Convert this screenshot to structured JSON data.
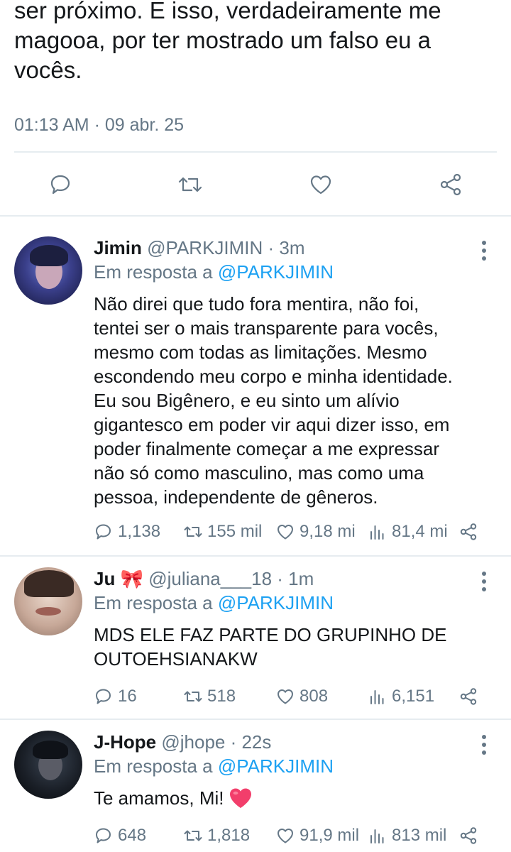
{
  "tweet": {
    "lines": [
      "ser próximo. E isso, verdadeiramente me",
      "magooa, por ter mostrado um falso eu a",
      "vocês."
    ],
    "timestamp": "01:13 AM · 09 abr. 25",
    "actions": [
      "reply-icon",
      "retweet-icon",
      "like-icon",
      "share-icon"
    ]
  },
  "replies": [
    {
      "name": "Jimin",
      "handle": "@PARKJIMIN · 3m",
      "reply_prefix": "Em resposta a ",
      "reply_mention": "@PARKJIMIN",
      "lines": [
        "Não direi que tudo fora mentira, não foi,",
        "tentei ser o mais transparente para vocês,",
        "mesmo com todas as limitações. Mesmo",
        "escondendo meu corpo e minha identidade.",
        "Eu sou Bigênero, e eu sinto um alívio",
        "gigantesco em poder vir aqui dizer isso, em",
        "poder finalmente começar a me expressar",
        "não só como masculino, mas como uma",
        "pessoa, independente de gêneros."
      ],
      "replies": "1,138",
      "retweets": "155 mil",
      "likes": "9,18 mi",
      "views": "81,4 mi"
    },
    {
      "name": "Ju",
      "name_emoji": "🎀",
      "handle": "@juliana___18 · 1m",
      "reply_prefix": "Em resposta a ",
      "reply_mention": "@PARKJIMIN",
      "lines": [
        "MDS ELE FAZ PARTE DO GRUPINHO DE",
        "OUTOEHSIANAKW"
      ],
      "replies": "16",
      "retweets": "518",
      "likes": "808",
      "views": "6,151"
    },
    {
      "name": "J-Hope",
      "handle": "@jhope · 22s",
      "reply_prefix": "Em resposta a ",
      "reply_mention": "@PARKJIMIN",
      "lines": [
        "Te amamos, Mi!"
      ],
      "emoji": "heart",
      "replies": "648",
      "retweets": "1,818",
      "likes": "91,9 mil",
      "views": "813 mil"
    }
  ],
  "colors": {
    "text": "#14171a",
    "muted": "#657786",
    "link": "#1da1f2",
    "divider": "#e6ecf0",
    "heart_emoji": "#f23e6b"
  }
}
